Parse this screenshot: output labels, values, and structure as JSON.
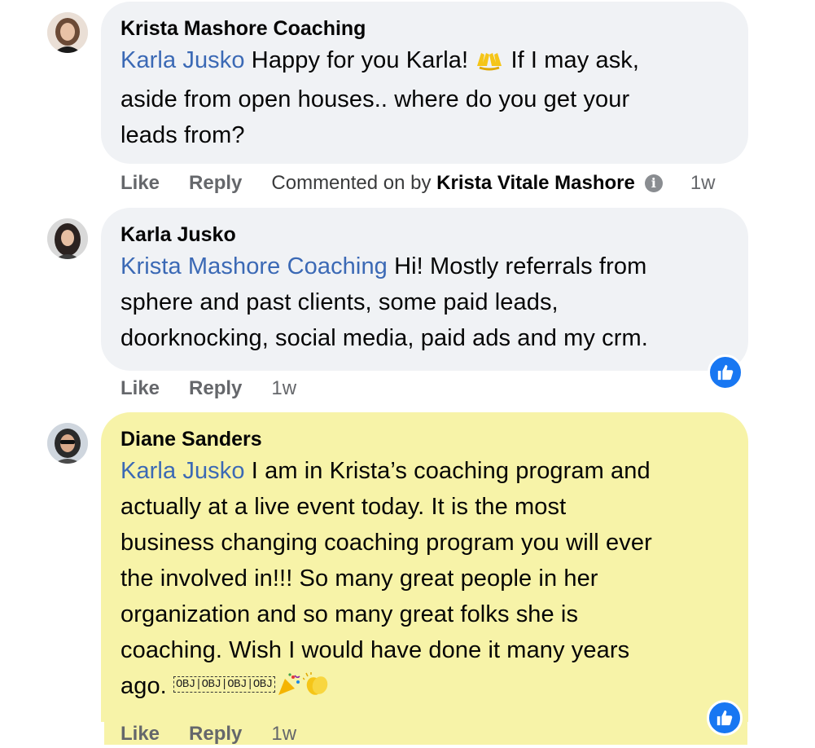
{
  "comments": [
    {
      "author": "Krista Mashore Coaching",
      "mention": "Karla Jusko",
      "text_line1_after_mention": " Happy for you Karla! ",
      "emoji1": "raising-hands",
      "text_line1_end": " If I may ask,",
      "text_line2": "aside from open houses.. where do you get your",
      "text_line3": "leads from?",
      "like_label": "Like",
      "reply_label": "Reply",
      "commented_prefix": "Commented on by",
      "commented_by": "Krista Vitale Mashore",
      "info_icon": "info-icon",
      "timestamp": "1w"
    },
    {
      "author": "Karla Jusko",
      "mention": "Krista Mashore Coaching",
      "text_line1_after_mention": " Hi! Mostly referrals from",
      "text_line2": "sphere and past clients, some paid leads,",
      "text_line3": "doorknocking, social media, paid ads and my crm.",
      "like_label": "Like",
      "reply_label": "Reply",
      "timestamp": "1w",
      "reaction": "like"
    },
    {
      "author": "Diane Sanders",
      "mention": "Karla Jusko",
      "text_line1_after_mention": " I am in Krista’s coaching program and",
      "text_line2": "actually at a live event today. It is the most",
      "text_line3": "business changing coaching program you will ever",
      "text_line4": "the involved in!!! So many great people in her",
      "text_line5": "organization and so many great folks she is",
      "text_line6": "coaching. Wish I would have done it many years",
      "text_line7": "ago. ",
      "obj_markers": [
        "OBJ",
        "OBJ",
        "OBJ",
        "OBJ"
      ],
      "emoji_end": [
        "party-popper",
        "clapping-hands"
      ],
      "like_label": "Like",
      "reply_label": "Reply",
      "timestamp": "1w",
      "reaction": "like",
      "highlight_color": "#f7f3a8"
    }
  ],
  "colors": {
    "bubble": "#f0f2f5",
    "highlight": "#f7f3a8",
    "mention": "#3b69b5",
    "like_blue": "#1877f2",
    "meta_gray": "#65676b"
  }
}
